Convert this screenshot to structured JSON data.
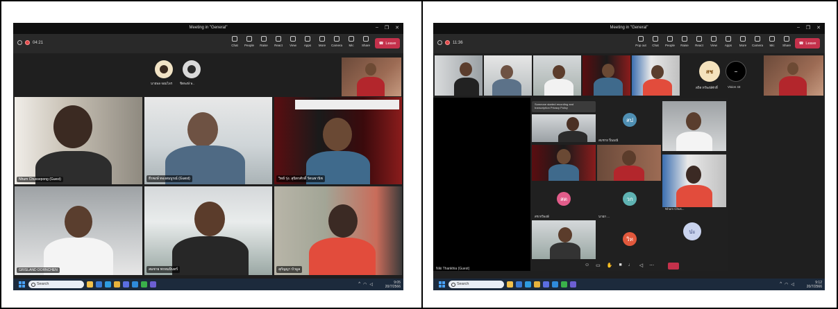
{
  "left": {
    "title": "Meeting in \"General\"",
    "timer": "04:21",
    "tools": [
      {
        "label": "Chat",
        "icon": "chat-icon"
      },
      {
        "label": "People",
        "icon": "people-icon"
      },
      {
        "label": "Raise",
        "icon": "raise-hand-icon"
      },
      {
        "label": "React",
        "icon": "react-icon"
      },
      {
        "label": "View",
        "icon": "view-icon"
      },
      {
        "label": "Apps",
        "icon": "apps-icon"
      },
      {
        "label": "More",
        "icon": "more-icon"
      },
      {
        "label": "Camera",
        "icon": "camera-icon"
      },
      {
        "label": "Mic",
        "icon": "mic-icon"
      },
      {
        "label": "Share",
        "icon": "share-icon"
      }
    ],
    "leave_label": "Leave",
    "top_avatars": [
      "นายพล จอมไพร",
      "ชิตพงษ์ พ.."
    ],
    "tiles": [
      {
        "name": "Nhum Chussepong (Guest)"
      },
      {
        "name": "ธีรพงษ์ ทองสมบูรณ์ (Guest)"
      },
      {
        "name": "วิทย์ รุ่ง. สุนิทรศักดิ์ รัตนพานิช"
      },
      {
        "name": "GRISLAND DORNCHEN"
      },
      {
        "name": "สมชาย พรหมมินทร์"
      },
      {
        "name": "สุกัญญา บัวมูล"
      }
    ],
    "search_label": "Search",
    "clock_time": "9:05",
    "clock_date": "20/7/2566"
  },
  "right": {
    "title": "Meeting in \"General\"",
    "timer": "11:36",
    "tools": [
      {
        "label": "Pop out",
        "icon": "pop-out-icon"
      },
      {
        "label": "Chat",
        "icon": "chat-icon"
      },
      {
        "label": "People",
        "icon": "people-icon"
      },
      {
        "label": "Raise",
        "icon": "raise-hand-icon"
      },
      {
        "label": "React",
        "icon": "react-icon"
      },
      {
        "label": "View",
        "icon": "view-icon"
      },
      {
        "label": "Apps",
        "icon": "apps-icon"
      },
      {
        "label": "More",
        "icon": "more-icon"
      },
      {
        "label": "Camera",
        "icon": "camera-icon"
      },
      {
        "label": "Mic",
        "icon": "mic-icon"
      },
      {
        "label": "Share",
        "icon": "share-icon"
      }
    ],
    "leave_label": "Leave",
    "strip_avatars": [
      {
        "initials": "สช",
        "name": "สถิต ทวีพงษ์ศักดิ์"
      },
      {
        "initials": "",
        "name": "Vision 43"
      }
    ],
    "notice": "Someone started recording and transcription Privacy Policy",
    "grid_avatars": [
      "สป",
      "สต",
      "วก",
      "วิท",
      "ปะ"
    ],
    "grid_names": [
      "สมชาย ปิ่นมณี",
      "นายก ...",
      "สช ทวีพงษ์",
      "Nhum Chus..."
    ],
    "bottom_name": "Niki Thankhia (Guest)",
    "search_label": "Search",
    "clock_time": "9:12",
    "clock_date": "20/7/2566"
  }
}
